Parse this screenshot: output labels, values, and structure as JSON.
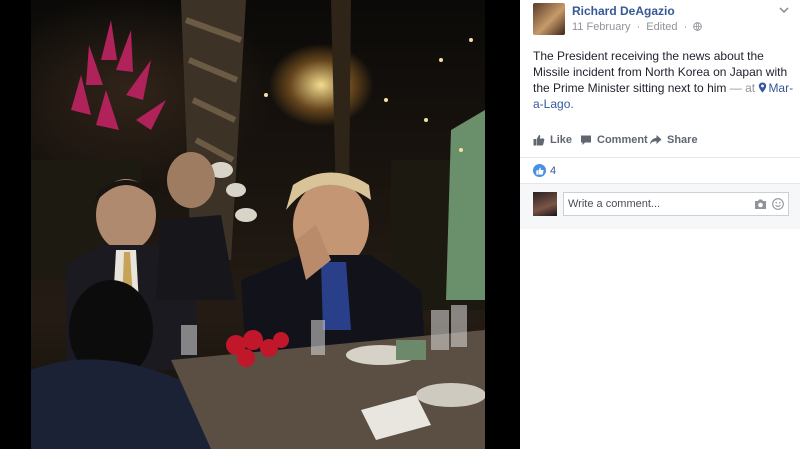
{
  "post": {
    "author": "Richard DeAgazio",
    "date": "11 February",
    "separator": "·",
    "edited": "Edited",
    "separator2": "·",
    "text": "The President receiving the news about the Missile incident from North Korea on Japan with the Prime Minister sitting next to him",
    "at_prefix": "— at",
    "location": "Mar-a-Lago."
  },
  "actions": {
    "like": "Like",
    "comment": "Comment",
    "share": "Share"
  },
  "reactions": {
    "count": "4",
    "color": "#4a90e2"
  },
  "comment_box": {
    "placeholder": "Write a comment..."
  },
  "icons": {
    "privacy": "globe-icon",
    "menu": "chevron-down-icon",
    "location": "map-pin-icon",
    "like": "thumbs-up-icon",
    "comment": "speech-bubble-icon",
    "share": "share-arrow-icon",
    "camera": "camera-icon",
    "emoji": "smiley-icon"
  },
  "colors": {
    "link": "#365899",
    "meta": "#90949c",
    "text": "#1d2129"
  }
}
